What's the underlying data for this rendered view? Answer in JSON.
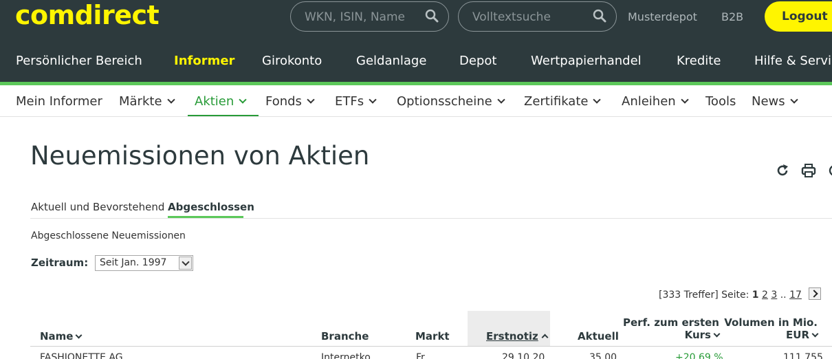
{
  "header": {
    "logo": "comdirect",
    "search_placeholder": "WKN, ISIN, Name",
    "fulltext_placeholder": "Volltextsuche",
    "musterdepot": "Musterdepot",
    "b2b": "B2B",
    "logout": "Logout"
  },
  "main_nav": [
    "Persönlicher Bereich",
    "Informer",
    "Girokonto",
    "Geldanlage",
    "Depot",
    "Wertpapierhandel",
    "Kredite",
    "Hilfe & Service"
  ],
  "sub_nav": [
    "Mein Informer",
    "Märkte",
    "Aktien",
    "Fonds",
    "ETFs",
    "Optionsscheine",
    "Zertifikate",
    "Anleihen",
    "Tools",
    "News"
  ],
  "page": {
    "title": "Neuemissionen von Aktien",
    "tabs": [
      "Aktuell und Bevorstehend",
      "Abgeschlossen"
    ],
    "subtitle": "Abgeschlossene Neuemissionen",
    "zeitraum_label": "Zeitraum:",
    "zeitraum_value": "Seit Jan. 1997"
  },
  "pager": {
    "hits": "[333 Treffer] Seite:",
    "current": "1",
    "p2": "2",
    "p3": "3",
    "dots": "..",
    "last": "17"
  },
  "table": {
    "headers": {
      "name": "Name",
      "branche": "Branche",
      "markt": "Markt",
      "erstnotiz": "Erstnotiz",
      "aktuell": "Aktuell",
      "perf_line1": "Perf. zum ersten",
      "perf_line2": "Kurs",
      "vol_line1": "Volumen in Mio.",
      "vol_line2": "EUR"
    },
    "rows": [
      {
        "name": "FASHIONETTE AG",
        "branche": "Internetko",
        "markt": "Fr",
        "erstnotiz": "29.10.20",
        "aktuell": "35,00",
        "perf": "+20,69 %",
        "volumen": "111,755"
      }
    ]
  },
  "colors": {
    "header_bg": "#2d3a3d",
    "brand_yellow": "#fff500",
    "accent_green": "#289b38",
    "line_green": "#5cc85a"
  }
}
